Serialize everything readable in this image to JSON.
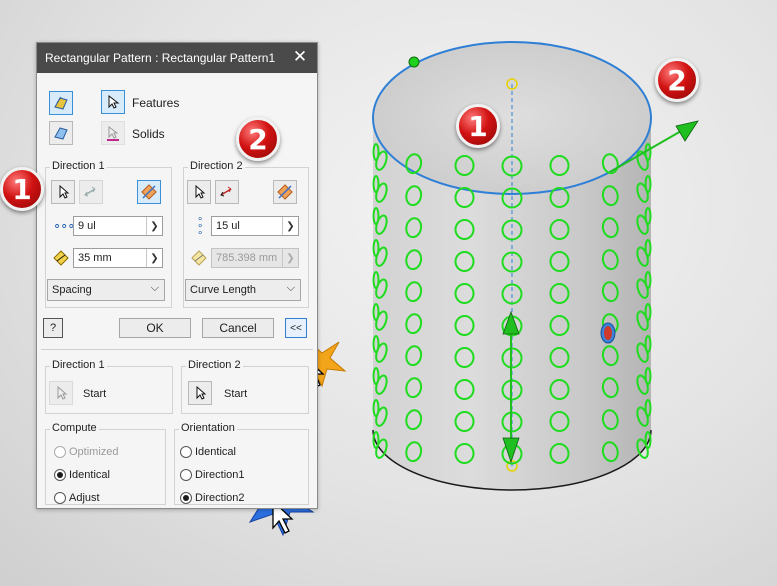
{
  "dialog": {
    "title": "Rectangular Pattern : Rectangular Pattern1",
    "features_label": "Features",
    "solids_label": "Solids"
  },
  "direction1": {
    "title": "Direction 1",
    "count": "9 ul",
    "spacing": "35 mm",
    "method": "Spacing"
  },
  "direction2": {
    "title": "Direction 2",
    "count": "15 ul",
    "spacing": "785.398 mm",
    "method": "Curve Length"
  },
  "buttons": {
    "ok": "OK",
    "cancel": "Cancel",
    "collapse": "<<",
    "help": "?"
  },
  "start": {
    "direction1_title": "Direction 1",
    "direction2_title": "Direction 2",
    "start_label": "Start"
  },
  "compute": {
    "title": "Compute",
    "options": [
      "Optimized",
      "Identical",
      "Adjust"
    ],
    "selected": "Identical"
  },
  "orientation": {
    "title": "Orientation",
    "options": [
      "Identical",
      "Direction1",
      "Direction2"
    ],
    "selected": "Direction2"
  },
  "callouts": {
    "one": "1",
    "two": "2"
  },
  "colors": {
    "titlebar": "#4a4a4a",
    "accent_blue": "#3b8fd6",
    "pattern_green": "#1fdc1f",
    "badge_red": "#d11212"
  }
}
